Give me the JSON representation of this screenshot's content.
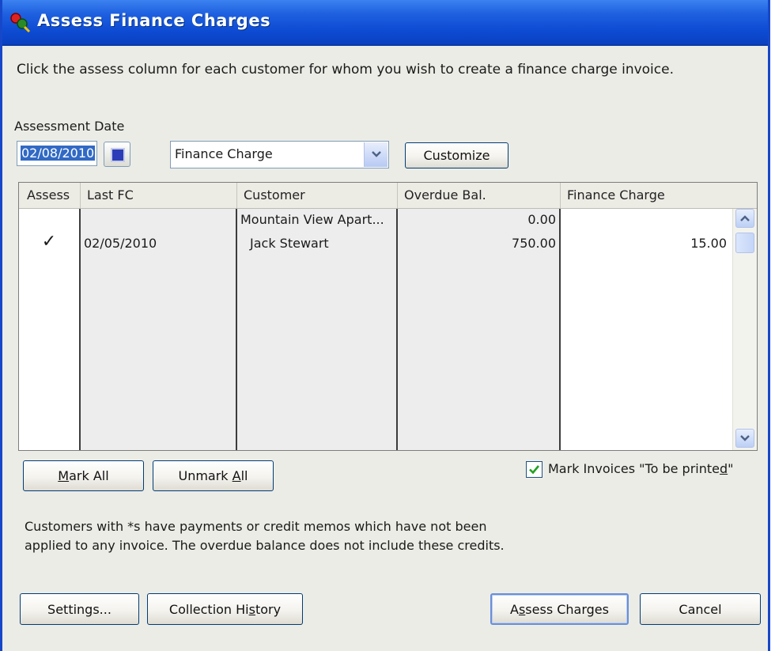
{
  "window": {
    "title": "Assess Finance Charges",
    "icon": "quickbooks-icon"
  },
  "instructions": "Click the assess column for each customer for whom you wish to create a finance charge invoice.",
  "assessment_date": {
    "label": "Assessment Date",
    "value": "02/08/2010",
    "icon": "calendar-icon"
  },
  "template": {
    "value": "Finance Charge",
    "icon": "chevron-down-icon"
  },
  "customize_label": "Customize",
  "table": {
    "columns": [
      "Assess",
      "Last FC",
      "Customer",
      "Overdue Bal.",
      "Finance Charge"
    ],
    "rows": [
      {
        "assess": "",
        "last_fc": "",
        "customer": "Mountain View Apart...",
        "overdue": "0.00",
        "finance_charge": ""
      },
      {
        "assess": "✓",
        "last_fc": "02/05/2010",
        "customer": "Jack Stewart",
        "overdue": "750.00",
        "finance_charge": "15.00"
      }
    ]
  },
  "buttons": {
    "mark_all": {
      "pre": "",
      "key": "M",
      "post": "ark All"
    },
    "unmark_all": {
      "pre": "Unmark ",
      "key": "A",
      "post": "ll"
    },
    "settings": {
      "pre": "Settings...",
      "key": "",
      "post": ""
    },
    "collection_history": {
      "pre": "Collection Hi",
      "key": "s",
      "post": "tory"
    },
    "assess_charges": {
      "pre": "A",
      "key": "s",
      "post": "sess Charges"
    },
    "cancel": {
      "pre": "Cancel",
      "key": "",
      "post": ""
    }
  },
  "mark_invoices": {
    "pre": "Mark Invoices \"To be printe",
    "key": "d",
    "post": "\"",
    "checked": true
  },
  "note": {
    "line1": "Customers with *s have payments or credit memos which have not been",
    "line2": "applied to any invoice.  The overdue balance does not include these credits."
  },
  "colors": {
    "title_bar": "#0d4bd3",
    "selection": "#316ac5",
    "dialog_bg": "#ecece6"
  }
}
